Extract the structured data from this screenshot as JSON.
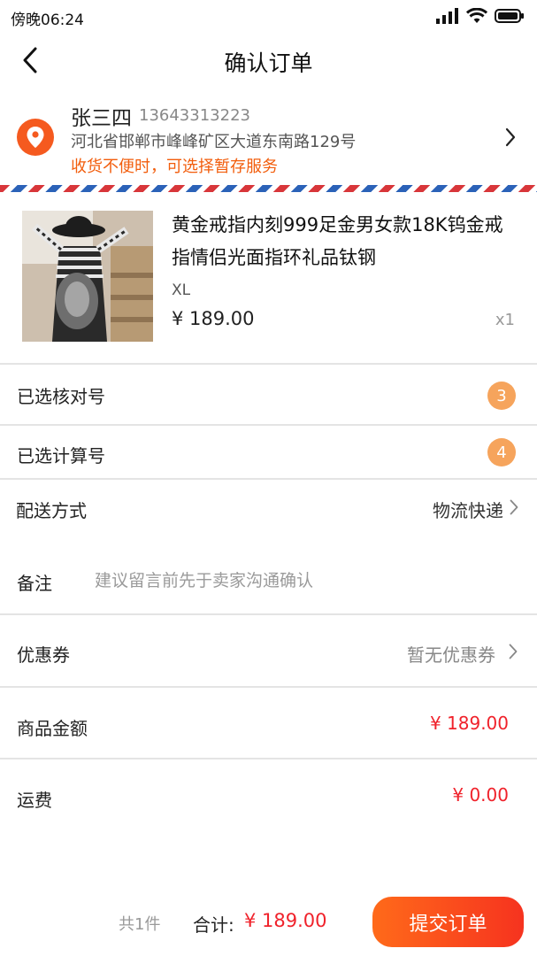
{
  "status_bar": {
    "time": "傍晚06:24",
    "icons": [
      "signal-icon",
      "wifi-icon",
      "battery-icon"
    ]
  },
  "header": {
    "title": "确认订单",
    "back_icon": "chevron-left-icon"
  },
  "address": {
    "name": "张三四",
    "phone": "13643313223",
    "detail": "河北省邯郸市峰峰矿区大道东南路129号",
    "note": "收货不便时，可选择暂存服务",
    "pin_icon": "location-pin-icon",
    "pin_color": "#f55a1f",
    "note_color": "#f25d0c"
  },
  "product": {
    "title": "黄金戒指内刻999足金男女款18K钨金戒指情侣光面指环礼品钛钢",
    "sku": "XL",
    "price": "¥ 189.00",
    "quantity": "x1"
  },
  "rows": {
    "checked_number": {
      "label": "已选核对号",
      "count": "3"
    },
    "calc_number": {
      "label": "已选计算号",
      "count": "4"
    },
    "delivery": {
      "label": "配送方式",
      "value": "物流快递"
    },
    "remark": {
      "label": "备注",
      "placeholder": "建议留言前先于卖家沟通确认"
    },
    "coupon": {
      "label": "优惠券",
      "value": "暂无优惠券"
    },
    "goods_amount": {
      "label": "商品金额",
      "value": "¥ 189.00"
    },
    "shipping": {
      "label": "运费",
      "value": "¥ 0.00"
    }
  },
  "footer": {
    "count": "共1件",
    "total_label": "合计:",
    "total_value": "¥ 189.00",
    "submit_label": "提交订单"
  },
  "colors": {
    "accent": "#f6331f",
    "price_red": "#f0222b",
    "badge": "#f6a45c"
  }
}
